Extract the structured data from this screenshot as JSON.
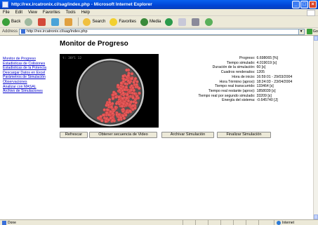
{
  "window": {
    "title": "http://rex.ircatronix.cl/sag/index.php - Microsoft Internet Explorer"
  },
  "menu": [
    "File",
    "Edit",
    "View",
    "Favorites",
    "Tools",
    "Help"
  ],
  "toolbar": {
    "back": "Back",
    "search": "Search",
    "favorites": "Favorites",
    "media": "Media"
  },
  "address": {
    "label": "Address",
    "url": "http://rex.ircatronix.cl/sag/index.php",
    "go": "Go"
  },
  "nav": {
    "links": [
      "Monitor de Progreso",
      "Estadisticas de Colisiones",
      "Estadisticas de la Potencia",
      "Descargar Datos en Excel",
      "Parámetros de Simulación",
      "Observaciones",
      "Analizar con MASAL",
      "Archivo de Simulaciones"
    ]
  },
  "main": {
    "title": "Monitor de Progreso",
    "canvas_label": "t: 38f1 12"
  },
  "stats": [
    {
      "k": "Progreso",
      "v": "6.698065 [%]"
    },
    {
      "k": "Tiempo simulado",
      "v": "4.019019 [s]"
    },
    {
      "k": "Duración de la simulación",
      "v": "60 [s]"
    },
    {
      "k": "Cuadros renderados",
      "v": "1205"
    },
    {
      "k": "Hora de inicio",
      "v": "16:59:01 - 29/03/2004"
    },
    {
      "k": "Hora Término (aprox)",
      "v": "18:24:03 - 23/04/2004"
    },
    {
      "k": "Tiempo real transcurrido",
      "v": "133464 [s]"
    },
    {
      "k": "Tiempo real restante (aprox)",
      "v": "1858039 [s]"
    },
    {
      "k": "Tiempo real por segundo simulado",
      "v": "33209 [s]"
    },
    {
      "k": "Energía del sistema",
      "v": "-0.645740 [J]"
    }
  ],
  "buttons": {
    "refresh": "Refrescar",
    "video": "Obtener secuencia de Video",
    "archive": "Archivar Simulación",
    "finish": "Finalizar Simulación"
  },
  "status": {
    "text": "Done",
    "zone": "Internet"
  },
  "colors": {
    "link": "#0000cc",
    "balls": "#e85a5a",
    "titlebar": "#0a52e0"
  }
}
